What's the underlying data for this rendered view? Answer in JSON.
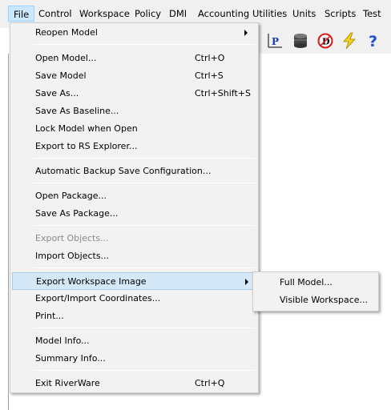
{
  "menubar": {
    "items": [
      {
        "label": "File",
        "active": true
      },
      {
        "label": "Control"
      },
      {
        "label": "Workspace"
      },
      {
        "label": "Policy"
      },
      {
        "label": "DMI"
      },
      {
        "label": "Accounting"
      },
      {
        "label": "Utilities"
      },
      {
        "label": "Units"
      },
      {
        "label": "Scripts"
      },
      {
        "label": "Test"
      }
    ]
  },
  "toolbar": {
    "icons": [
      "plot-p-icon",
      "database-icon",
      "dmi-icon",
      "lightning-icon",
      "help-icon"
    ],
    "glyphs": {
      "plot": "P",
      "dmi": "D",
      "help": "?"
    }
  },
  "file_menu": {
    "items": [
      {
        "label": "Reopen Model",
        "submenu": true
      },
      {
        "label": "Open Model...",
        "shortcut": "Ctrl+O"
      },
      {
        "label": "Save Model",
        "shortcut": "Ctrl+S"
      },
      {
        "label": "Save As...",
        "shortcut": "Ctrl+Shift+S"
      },
      {
        "label": "Save As Baseline..."
      },
      {
        "label": "Lock Model when Open"
      },
      {
        "label": "Export to RS Explorer..."
      },
      {
        "label": "Automatic Backup Save Configuration..."
      },
      {
        "label": "Open Package..."
      },
      {
        "label": "Save As Package..."
      },
      {
        "label": "Export Objects...",
        "disabled": true
      },
      {
        "label": "Import Objects..."
      },
      {
        "label": "Export Workspace Image",
        "submenu": true,
        "highlighted": true
      },
      {
        "label": "Export/Import Coordinates..."
      },
      {
        "label": "Print..."
      },
      {
        "label": "Model Info..."
      },
      {
        "label": "Summary Info..."
      },
      {
        "label": "Exit RiverWare",
        "shortcut": "Ctrl+Q"
      }
    ]
  },
  "export_image_submenu": {
    "items": [
      {
        "label": "Full Model..."
      },
      {
        "label": "Visible Workspace..."
      }
    ]
  },
  "colors": {
    "menu_background": "#f2f2f2",
    "highlight": "#d5e8f8",
    "disabled_text": "#8a8a8a",
    "lightning": "#f2d21c",
    "help": "#1a4fd6",
    "dmi_red": "#d61a1a"
  }
}
